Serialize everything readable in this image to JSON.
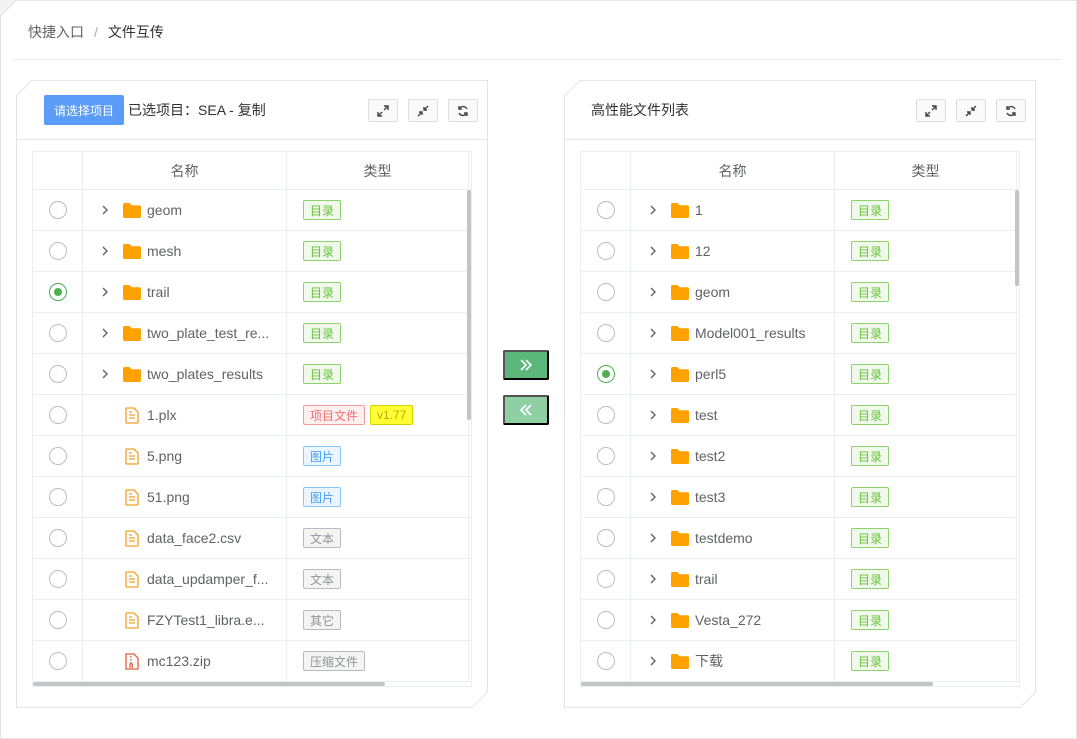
{
  "breadcrumb": {
    "home": "快捷入口",
    "separator": "/",
    "current": "文件互传"
  },
  "left_panel": {
    "select_button": "请选择项目",
    "selected_label": "已选项目：SEA - 复制",
    "columns": {
      "name": "名称",
      "type": "类型"
    },
    "rows": [
      {
        "name": "geom",
        "kind": "folder",
        "checked": false,
        "tags": [
          {
            "label": "目录",
            "style": "dir"
          }
        ]
      },
      {
        "name": "mesh",
        "kind": "folder",
        "checked": false,
        "tags": [
          {
            "label": "目录",
            "style": "dir"
          }
        ]
      },
      {
        "name": "trail",
        "kind": "folder",
        "checked": true,
        "tags": [
          {
            "label": "目录",
            "style": "dir"
          }
        ]
      },
      {
        "name": "two_plate_test_re...",
        "kind": "folder",
        "checked": false,
        "tags": [
          {
            "label": "目录",
            "style": "dir"
          }
        ]
      },
      {
        "name": "two_plates_results",
        "kind": "folder",
        "checked": false,
        "tags": [
          {
            "label": "目录",
            "style": "dir"
          }
        ]
      },
      {
        "name": "1.plx",
        "kind": "file",
        "checked": false,
        "tags": [
          {
            "label": "项目文件",
            "style": "proj"
          },
          {
            "label": "v1.77",
            "style": "ver"
          }
        ]
      },
      {
        "name": "5.png",
        "kind": "file",
        "checked": false,
        "tags": [
          {
            "label": "图片",
            "style": "img"
          }
        ]
      },
      {
        "name": "51.png",
        "kind": "file",
        "checked": false,
        "tags": [
          {
            "label": "图片",
            "style": "img"
          }
        ]
      },
      {
        "name": "data_face2.csv",
        "kind": "file",
        "checked": false,
        "tags": [
          {
            "label": "文本",
            "style": "txt"
          }
        ]
      },
      {
        "name": "data_updamper_f...",
        "kind": "file",
        "checked": false,
        "tags": [
          {
            "label": "文本",
            "style": "txt"
          }
        ]
      },
      {
        "name": "FZYTest1_libra.e...",
        "kind": "file",
        "checked": false,
        "tags": [
          {
            "label": "其它",
            "style": "txt"
          }
        ]
      },
      {
        "name": "mc123.zip",
        "kind": "zip",
        "checked": false,
        "tags": [
          {
            "label": "压缩文件",
            "style": "txt"
          }
        ]
      }
    ]
  },
  "right_panel": {
    "title": "高性能文件列表",
    "columns": {
      "name": "名称",
      "type": "类型"
    },
    "rows": [
      {
        "name": "1",
        "kind": "folder",
        "checked": false,
        "tags": [
          {
            "label": "目录",
            "style": "dir"
          }
        ]
      },
      {
        "name": "12",
        "kind": "folder",
        "checked": false,
        "tags": [
          {
            "label": "目录",
            "style": "dir"
          }
        ]
      },
      {
        "name": "geom",
        "kind": "folder",
        "checked": false,
        "tags": [
          {
            "label": "目录",
            "style": "dir"
          }
        ]
      },
      {
        "name": "Model001_results",
        "kind": "folder",
        "checked": false,
        "tags": [
          {
            "label": "目录",
            "style": "dir"
          }
        ]
      },
      {
        "name": "perl5",
        "kind": "folder",
        "checked": true,
        "tags": [
          {
            "label": "目录",
            "style": "dir"
          }
        ]
      },
      {
        "name": "test",
        "kind": "folder",
        "checked": false,
        "tags": [
          {
            "label": "目录",
            "style": "dir"
          }
        ]
      },
      {
        "name": "test2",
        "kind": "folder",
        "checked": false,
        "tags": [
          {
            "label": "目录",
            "style": "dir"
          }
        ]
      },
      {
        "name": "test3",
        "kind": "folder",
        "checked": false,
        "tags": [
          {
            "label": "目录",
            "style": "dir"
          }
        ]
      },
      {
        "name": "testdemo",
        "kind": "folder",
        "checked": false,
        "tags": [
          {
            "label": "目录",
            "style": "dir"
          }
        ]
      },
      {
        "name": "trail",
        "kind": "folder",
        "checked": false,
        "tags": [
          {
            "label": "目录",
            "style": "dir"
          }
        ]
      },
      {
        "name": "Vesta_272",
        "kind": "folder",
        "checked": false,
        "tags": [
          {
            "label": "目录",
            "style": "dir"
          }
        ]
      },
      {
        "name": "下载",
        "kind": "folder",
        "checked": false,
        "tags": [
          {
            "label": "目录",
            "style": "dir"
          }
        ]
      }
    ]
  },
  "icons": {
    "expand": "expand-icon",
    "collapse": "collapse-icon",
    "refresh": "refresh-icon",
    "transfer_right": "double-chevron-right-icon",
    "transfer_left": "double-chevron-left-icon"
  },
  "colors": {
    "primary": "#5a9cf8",
    "folder": "#ffa200",
    "file": "#f0a020",
    "zip": "#e05a3a",
    "transfer": "#5bb87a",
    "checked": "#4caf50"
  }
}
